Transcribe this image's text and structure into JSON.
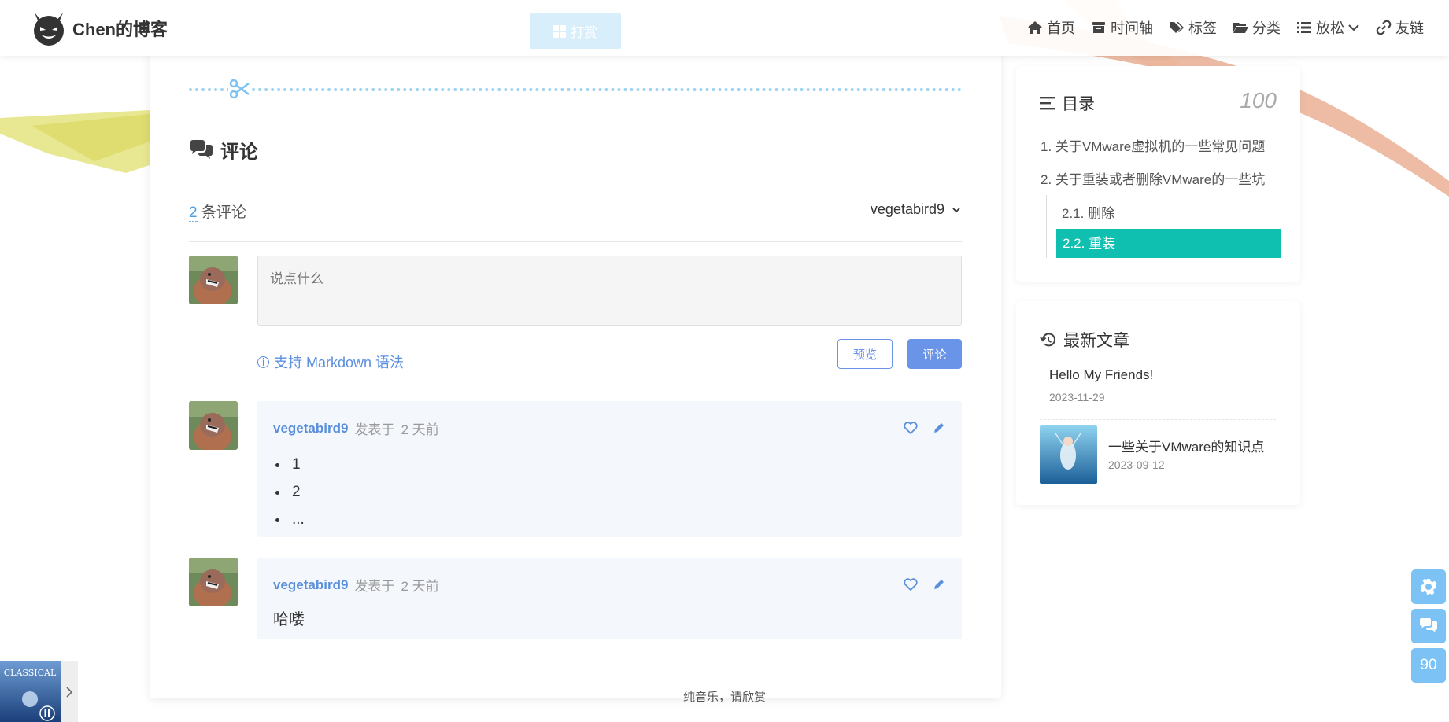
{
  "header": {
    "site_name": "Chen的博客",
    "reward_label": "打赏",
    "nav": [
      {
        "label": "首页",
        "icon": "home-icon"
      },
      {
        "label": "时间轴",
        "icon": "archive-icon"
      },
      {
        "label": "标签",
        "icon": "tags-icon"
      },
      {
        "label": "分类",
        "icon": "folder-icon"
      },
      {
        "label": "放松",
        "icon": "list-icon"
      },
      {
        "label": "友链",
        "icon": "link-icon"
      }
    ]
  },
  "comments": {
    "title": "评论",
    "count": "2",
    "count_suffix": "条评论",
    "current_user": "vegetabird9",
    "placeholder": "说点什么",
    "markdown_hint": "支持 Markdown 语法",
    "preview_label": "预览",
    "submit_label": "评论",
    "items": [
      {
        "author": "vegetabird9",
        "posted": "发表于",
        "time": "2 天前",
        "list": [
          "1",
          "2",
          "..."
        ]
      },
      {
        "author": "vegetabird9",
        "posted": "发表于",
        "time": "2 天前",
        "text": "哈喽"
      }
    ]
  },
  "toc": {
    "title": "目录",
    "progress": "100",
    "items": [
      "1. 关于VMware虚拟机的一些常见问题",
      "2. 关于重装或者删除VMware的一些坑",
      "2.1. 删除",
      "2.2. 重装"
    ]
  },
  "recent": {
    "title": "最新文章",
    "items": [
      {
        "title": "Hello My Friends!",
        "date": "2023-11-29"
      },
      {
        "title": "一些关于VMware的知识点",
        "date": "2023-09-12"
      }
    ]
  },
  "floating": {
    "counter": "90"
  },
  "player": {
    "cover_text": "CLASSICAL",
    "caption": "纯音乐，请欣赏"
  },
  "colors": {
    "accent": "#6a94e8",
    "toc_active": "#0fc0b0",
    "float": "#7cc2f5"
  }
}
